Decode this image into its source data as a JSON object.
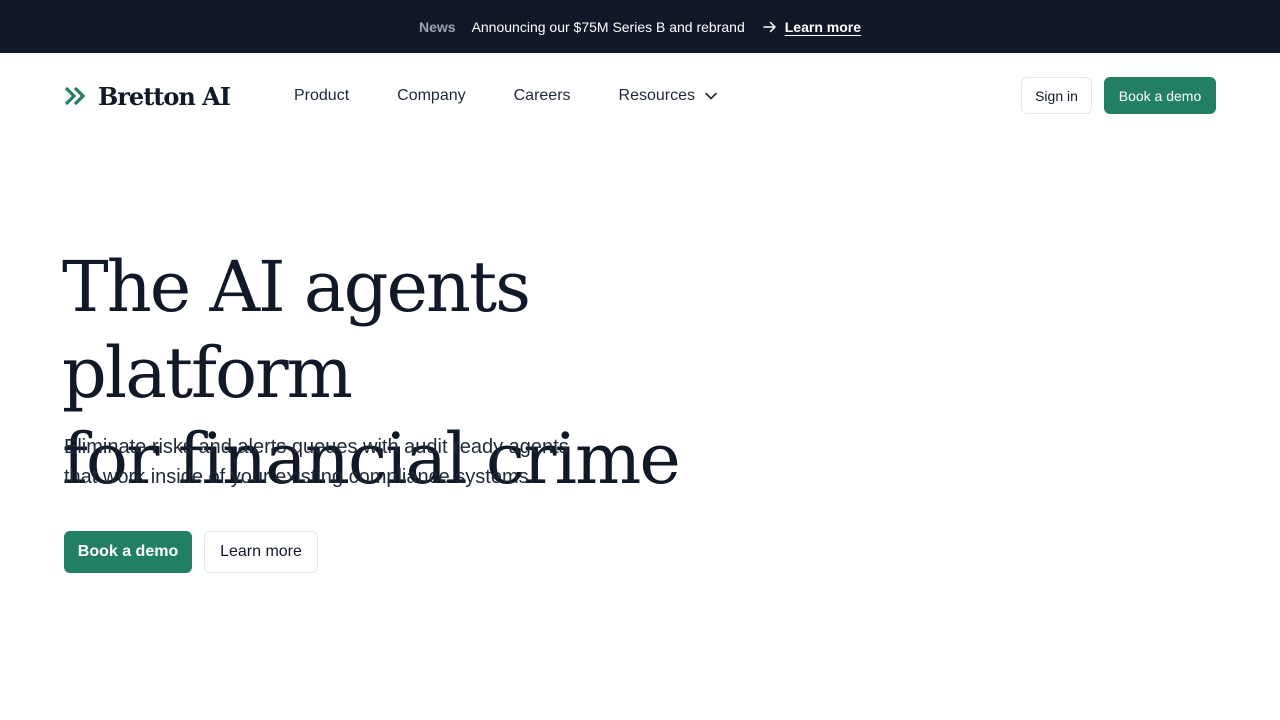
{
  "announcement": {
    "tag": "News",
    "message": "Announcing our $75M Series B and rebrand",
    "link_label": "Learn more",
    "arrow_icon": "arrow-right-icon"
  },
  "nav": {
    "brand": "Bretton AI",
    "logo_icon": "double-chevron-logo-icon",
    "items": [
      {
        "label": "Product"
      },
      {
        "label": "Company"
      },
      {
        "label": "Careers"
      },
      {
        "label": "Resources",
        "icon": "chevron-down-icon"
      }
    ],
    "sign_in_label": "Sign in",
    "book_demo_label": "Book a demo"
  },
  "hero": {
    "title_line1": "The AI agents platform",
    "title_line2": "for financial crime",
    "subtitle_line1": "Eliminate risks and alerts queues with audit ready agents",
    "subtitle_line2": "that work inside of your existing compliance systems.",
    "primary_cta": "Book a demo",
    "secondary_cta": "Learn more"
  },
  "colors": {
    "brand_green": "#237f63",
    "dark_navy": "#111827",
    "border": "#e5e7eb"
  }
}
